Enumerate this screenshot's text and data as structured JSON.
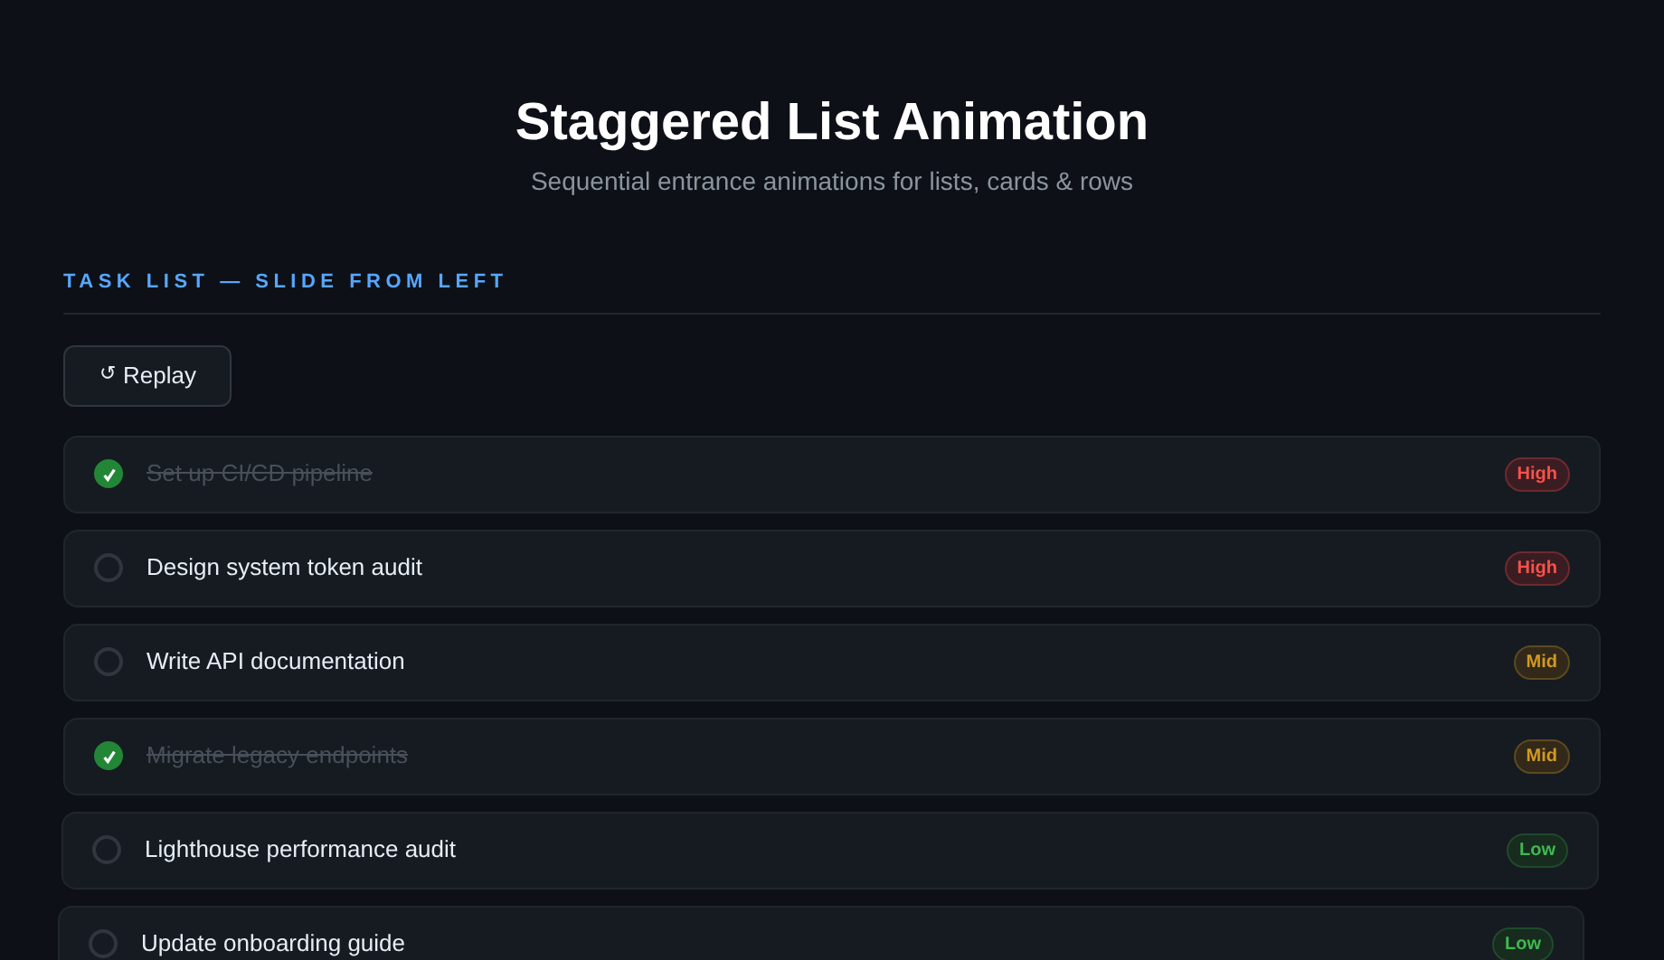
{
  "header": {
    "title": "Staggered List Animation",
    "subtitle": "Sequential entrance animations for lists, cards & rows"
  },
  "section": {
    "title": "TASK LIST — SLIDE FROM LEFT"
  },
  "replay_button": {
    "icon": "↺",
    "label": "Replay"
  },
  "tasks": [
    {
      "label": "Set up CI/CD pipeline",
      "checked": true,
      "priority": {
        "kind": "high",
        "label": "High"
      }
    },
    {
      "label": "Design system token audit",
      "checked": false,
      "priority": {
        "kind": "high",
        "label": "High"
      }
    },
    {
      "label": "Write API documentation",
      "checked": false,
      "priority": {
        "kind": "mid",
        "label": "Mid"
      }
    },
    {
      "label": "Migrate legacy endpoints",
      "checked": true,
      "priority": {
        "kind": "mid",
        "label": "Mid"
      }
    },
    {
      "label": "Lighthouse performance audit",
      "checked": false,
      "priority": {
        "kind": "low",
        "label": "Low"
      }
    },
    {
      "label": "Update onboarding guide",
      "checked": false,
      "priority": {
        "kind": "low",
        "label": "Low"
      }
    }
  ]
}
